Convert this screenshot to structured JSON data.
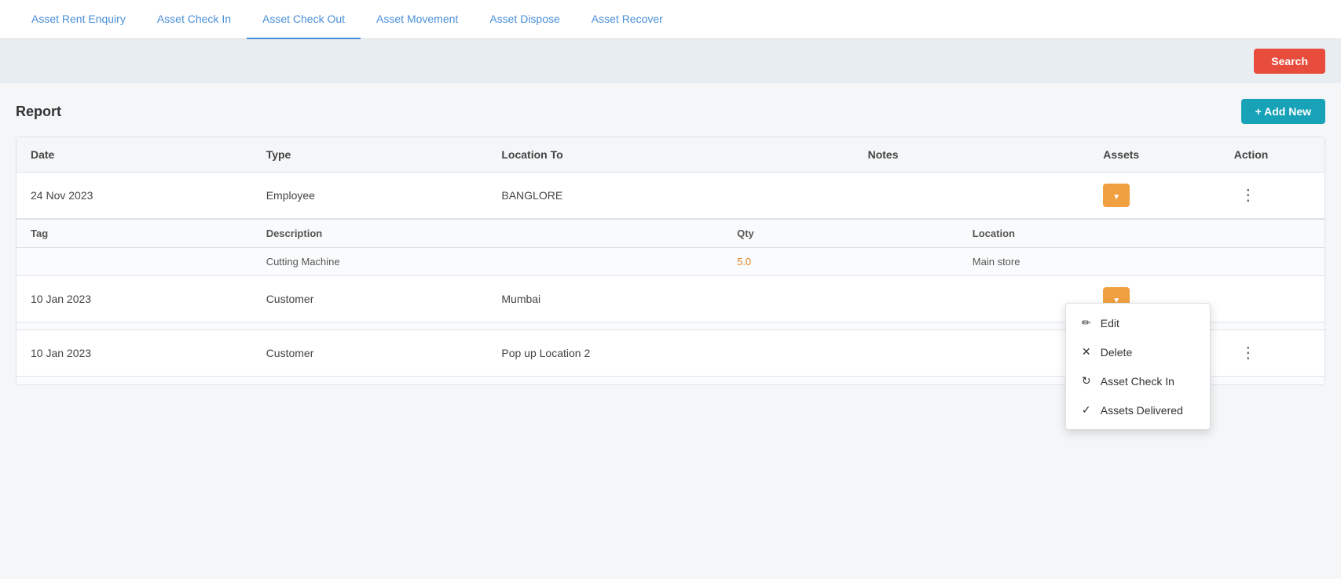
{
  "nav": {
    "tabs": [
      {
        "label": "Asset Rent Enquiry",
        "active": false
      },
      {
        "label": "Asset Check In",
        "active": false
      },
      {
        "label": "Asset Check Out",
        "active": true
      },
      {
        "label": "Asset Movement",
        "active": false
      },
      {
        "label": "Asset Dispose",
        "active": false
      },
      {
        "label": "Asset Recover",
        "active": false
      }
    ]
  },
  "toolbar": {
    "search_label": "Search",
    "add_new_label": "+ Add New"
  },
  "report": {
    "title": "Report",
    "table": {
      "columns": [
        "Date",
        "Type",
        "Location To",
        "Notes",
        "Assets",
        "Action"
      ],
      "sub_columns": [
        "Tag",
        "Description",
        "Qty",
        "Location"
      ],
      "rows": [
        {
          "date": "24 Nov 2023",
          "type": "Employee",
          "location": "BANGLORE",
          "notes": "",
          "has_assets_btn": true,
          "has_action": true,
          "show_menu": false,
          "sub_rows": [
            {
              "tag": "",
              "description": "Cutting Machine",
              "qty": "5.0",
              "location": "Main store"
            }
          ]
        },
        {
          "date": "10 Jan 2023",
          "type": "Customer",
          "location": "Mumbai",
          "notes": "",
          "has_assets_btn": true,
          "has_action": false,
          "show_menu": true,
          "sub_rows": []
        },
        {
          "date": "10 Jan 2023",
          "type": "Customer",
          "location": "Pop up Location 2",
          "notes": "",
          "has_assets_btn": true,
          "has_action": true,
          "show_menu": false,
          "sub_rows": []
        }
      ]
    }
  },
  "context_menu": {
    "items": [
      {
        "label": "Edit",
        "icon": "✏"
      },
      {
        "label": "Delete",
        "icon": "✕"
      },
      {
        "label": "Asset Check In",
        "icon": "↻"
      },
      {
        "label": "Assets Delivered",
        "icon": "✓"
      }
    ]
  }
}
